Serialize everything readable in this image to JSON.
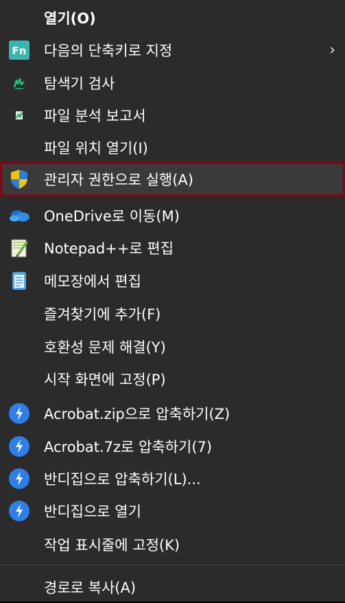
{
  "menu": {
    "items": [
      {
        "label": "열기(O)"
      },
      {
        "label": "다음의 단축키로 지정",
        "arrow": "›",
        "icon": "fn-key-icon",
        "icon_text": "Fn"
      },
      {
        "label": "탐색기 검사",
        "icon": "scanner-icon"
      },
      {
        "label": "파일 분석 보고서",
        "icon": "report-icon"
      },
      {
        "label": "파일 위치 열기(I)"
      },
      {
        "label": "관리자 권한으로 실행(A)",
        "icon": "shield-icon"
      },
      {
        "label": "OneDrive로 이동(M)",
        "icon": "onedrive-icon"
      },
      {
        "label": "Notepad++로 편집",
        "icon": "notepadpp-icon"
      },
      {
        "label": "메모장에서 편집",
        "icon": "notepad-icon"
      },
      {
        "label": "즐겨찾기에 추가(F)"
      },
      {
        "label": "호환성 문제 해결(Y)"
      },
      {
        "label": "시작 화면에 고정(P)"
      },
      {
        "label": "Acrobat.zip으로 압축하기(Z)",
        "icon": "bandizip-icon"
      },
      {
        "label": "Acrobat.7z로 압축하기(7)",
        "icon": "bandizip-icon"
      },
      {
        "label": "반디집으로 압축하기(L)...",
        "icon": "bandizip-icon"
      },
      {
        "label": "반디집으로 열기",
        "icon": "bandizip-icon"
      },
      {
        "label": "작업 표시줄에 고정(K)"
      },
      {
        "label": "경로로 복사(A)"
      }
    ],
    "colors": {
      "background": "#2b2b2b",
      "text": "#ffffff",
      "highlight_border": "#8b0014",
      "fn_icon": "#39b6b0",
      "bandizip_blue": "#2f7fe6",
      "onedrive_blue": "#2f8fe8",
      "shield_blue": "#2b7de0",
      "shield_yellow": "#f5c400"
    }
  }
}
